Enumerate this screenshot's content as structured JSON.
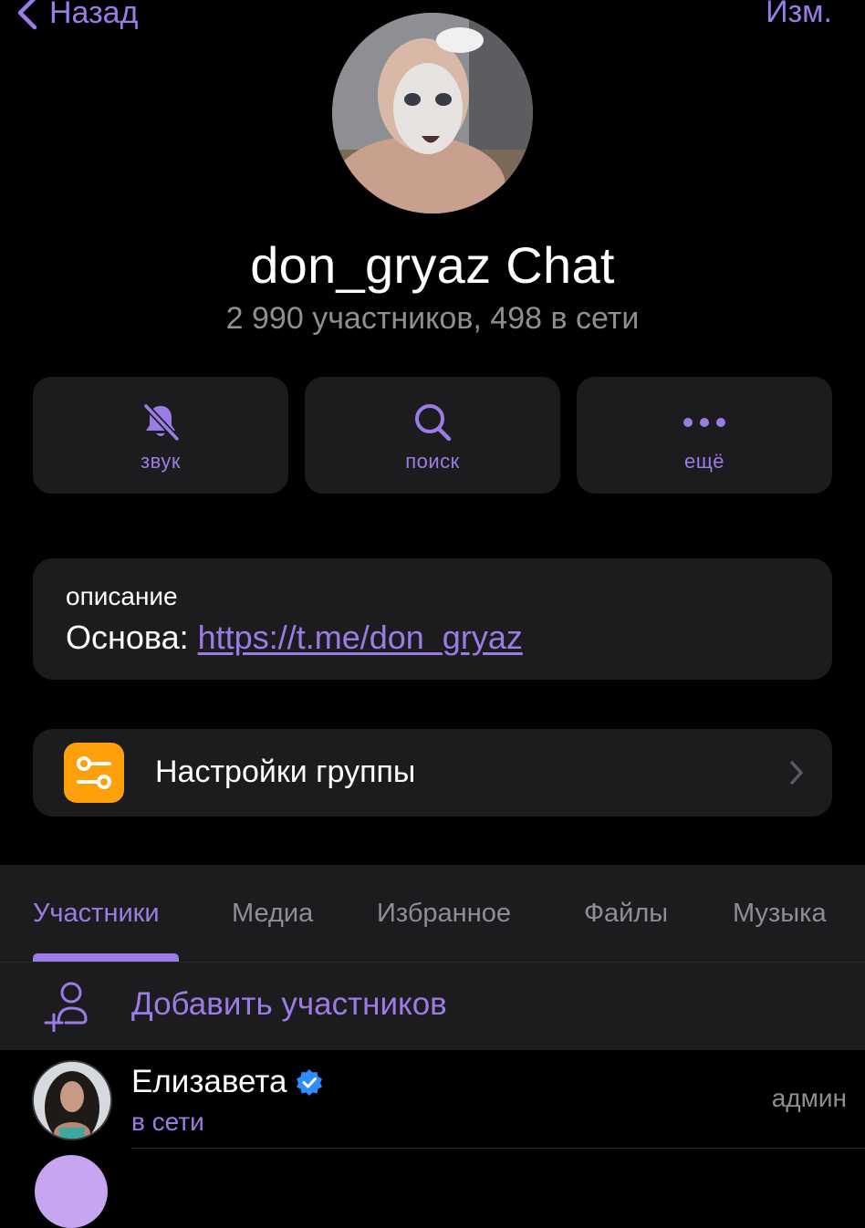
{
  "nav": {
    "back_label": "Назад",
    "edit_label": "Изм."
  },
  "chat": {
    "title": "don_gryaz Chat",
    "subtitle": "2 990 участников, 498 в сети"
  },
  "actions": [
    {
      "label": "звук",
      "icon": "bell-slash-icon"
    },
    {
      "label": "поиск",
      "icon": "search-icon"
    },
    {
      "label": "ещё",
      "icon": "more-dots-icon"
    }
  ],
  "description": {
    "key": "описание",
    "prefix": "Основа: ",
    "link": "https://t.me/don_gryaz"
  },
  "settings": {
    "label": "Настройки группы",
    "icon": "sliders-icon",
    "icon_color": "#ff9f0a"
  },
  "tabs": [
    "Участники",
    "Медиа",
    "Избранное",
    "Файлы",
    "Музыка"
  ],
  "active_tab": "Участники",
  "add_members": {
    "label": "Добавить участников",
    "icon": "add-person-icon"
  },
  "members": [
    {
      "name": "Елизавета",
      "verified": true,
      "status": "в сети",
      "role": "админ"
    }
  ],
  "colors": {
    "accent": "#9b7ce6",
    "background": "#000000",
    "card": "#1c1c1e",
    "muted": "#8e8e93",
    "verified": "#2f8cff"
  }
}
